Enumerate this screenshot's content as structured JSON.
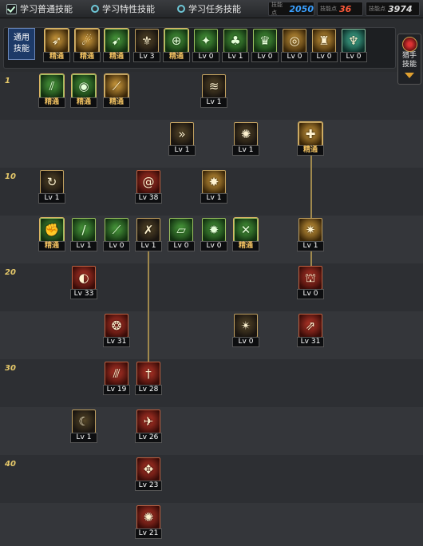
{
  "header": {
    "options": [
      {
        "label": "学习普通技能",
        "checked": true
      },
      {
        "label": "学习特性技能",
        "checked": false
      },
      {
        "label": "学习任务技能",
        "checked": false
      }
    ],
    "points": [
      {
        "tag": "技能点",
        "value": "2050",
        "color": "#3aa0ff"
      },
      {
        "tag": "技能点",
        "value": "36",
        "color": "#ff5a3a"
      },
      {
        "tag": "技能点",
        "value": "3974",
        "color": "#dddddd"
      }
    ]
  },
  "general": {
    "label_line1": "通用",
    "label_line2": "技能",
    "skills": [
      {
        "cap": "精通",
        "icon": "sprint-icon"
      },
      {
        "cap": "精通",
        "icon": "leap-icon"
      },
      {
        "cap": "精通",
        "icon": "dash-icon"
      },
      {
        "cap": "Lv 3",
        "icon": "wings-icon"
      },
      {
        "cap": "精通",
        "icon": "crosshair-icon"
      },
      {
        "cap": "Lv 0",
        "icon": "orb-icon"
      },
      {
        "cap": "Lv 1",
        "icon": "mushroom-icon"
      },
      {
        "cap": "Lv 0",
        "icon": "crown-icon"
      },
      {
        "cap": "Lv 0",
        "icon": "eye-icon"
      },
      {
        "cap": "Lv 0",
        "icon": "warrior-icon"
      },
      {
        "cap": "Lv 0",
        "icon": "totem-icon"
      }
    ]
  },
  "side_tab": {
    "line1": "猎手",
    "line2": "技能"
  },
  "levels": [
    "1",
    "10",
    "20",
    "30",
    "40"
  ],
  "tree": [
    {
      "cap": "精通",
      "icon": "slash-icon"
    },
    {
      "cap": "精通",
      "icon": "eye-icon"
    },
    {
      "cap": "精通",
      "icon": "arc-icon"
    },
    {
      "cap": "Lv 1",
      "icon": "swirl-icon"
    },
    {
      "cap": "Lv 1",
      "icon": "arrows-icon"
    },
    {
      "cap": "Lv 1",
      "icon": "fan-icon"
    },
    {
      "cap": "精通",
      "icon": "shield-icon"
    },
    {
      "cap": "Lv 1",
      "icon": "spin-icon"
    },
    {
      "cap": "Lv 38",
      "icon": "vortex-icon"
    },
    {
      "cap": "Lv 1",
      "icon": "burst-icon"
    },
    {
      "cap": "精通",
      "icon": "fist-icon"
    },
    {
      "cap": "Lv 1",
      "icon": "blade-icon"
    },
    {
      "cap": "Lv 0",
      "icon": "sword-icon"
    },
    {
      "cap": "Lv 1",
      "icon": "combo-icon"
    },
    {
      "cap": "Lv 0",
      "icon": "dagger-icon"
    },
    {
      "cap": "Lv 0",
      "icon": "star-icon"
    },
    {
      "cap": "精通",
      "icon": "cross-blade-icon"
    },
    {
      "cap": "Lv 1",
      "icon": "impact-icon"
    },
    {
      "cap": "Lv 33",
      "icon": "crescent-icon"
    },
    {
      "cap": "Lv 0",
      "icon": "gate-icon"
    },
    {
      "cap": "Lv 31",
      "icon": "flame-slash-icon"
    },
    {
      "cap": "Lv 0",
      "icon": "explosion-icon"
    },
    {
      "cap": "Lv 31",
      "icon": "rush-icon"
    },
    {
      "cap": "Lv 19",
      "icon": "claw-icon"
    },
    {
      "cap": "Lv 28",
      "icon": "sword-rain-icon"
    },
    {
      "cap": "Lv 1",
      "icon": "moon-icon"
    },
    {
      "cap": "Lv 26",
      "icon": "phoenix-icon"
    },
    {
      "cap": "Lv 23",
      "icon": "compass-icon"
    },
    {
      "cap": "Lv 21",
      "icon": "meteor-icon"
    }
  ]
}
